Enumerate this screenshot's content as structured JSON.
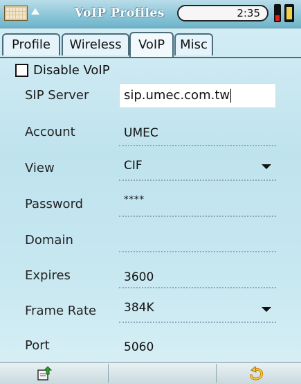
{
  "statusbar": {
    "title": "VoIP Profiles",
    "time": "2:35",
    "icons": [
      "keyboard-icon",
      "arrow-up-icon",
      "battery-icon"
    ]
  },
  "tabs": [
    {
      "label": "Profile",
      "active": false
    },
    {
      "label": "Wireless",
      "active": false
    },
    {
      "label": "VoIP",
      "active": true
    },
    {
      "label": "Misc",
      "active": false
    }
  ],
  "form": {
    "disable_voip": {
      "label": "Disable VoIP",
      "checked": false
    },
    "sip_server": {
      "label": "SIP Server",
      "value": "sip.umec.com.tw"
    },
    "account": {
      "label": "Account",
      "value": "UMEC"
    },
    "view": {
      "label": "View",
      "value": "CIF"
    },
    "password": {
      "label": "Password",
      "value": "****"
    },
    "domain": {
      "label": "Domain",
      "value": ""
    },
    "expires": {
      "label": "Expires",
      "value": "3600"
    },
    "frame_rate": {
      "label": "Frame Rate",
      "value": "384K"
    },
    "port": {
      "label": "Port",
      "value": "5060"
    }
  },
  "bottombar": {
    "icons": [
      "export-icon",
      "back-icon"
    ]
  },
  "colors": {
    "background": "#c7e7f0",
    "statusbar": "#8cc6d8",
    "tab_border": "#4b6c7b"
  }
}
